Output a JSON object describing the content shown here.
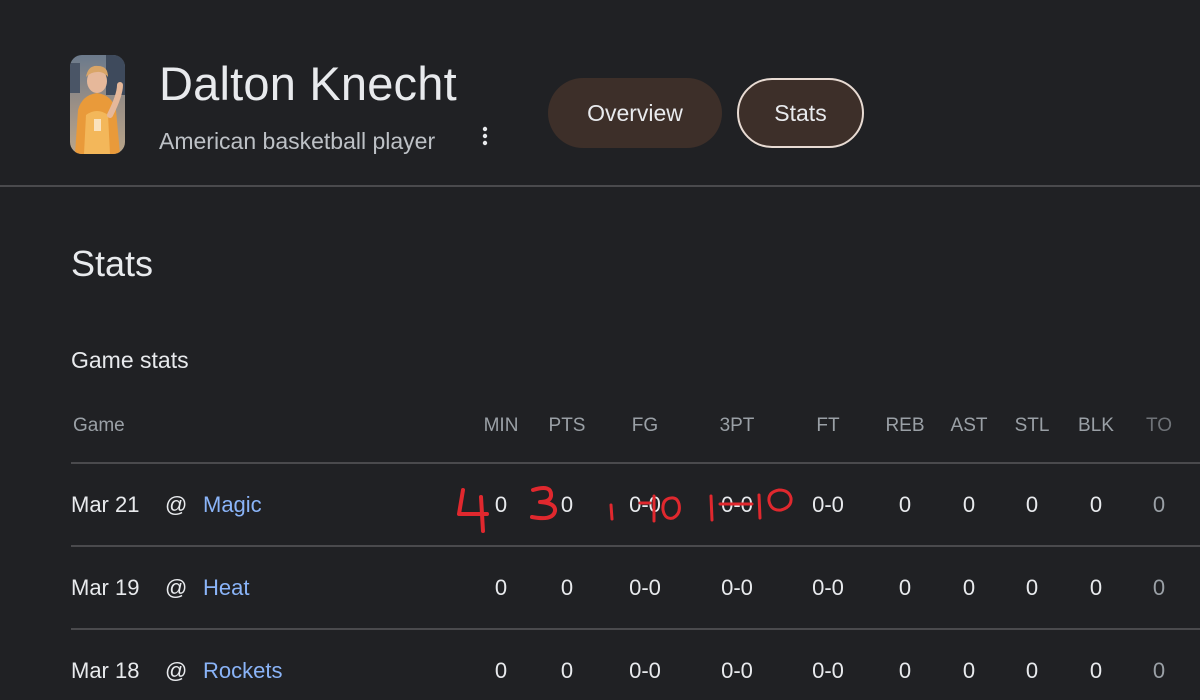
{
  "player": {
    "name": "Dalton Knecht",
    "description": "American basketball player"
  },
  "tabs": {
    "overview": "Overview",
    "stats": "Stats",
    "selected": "Stats"
  },
  "section": {
    "title": "Stats",
    "subtitle": "Game stats"
  },
  "table": {
    "headers": {
      "game": "Game",
      "min": "MIN",
      "pts": "PTS",
      "fg": "FG",
      "tpt": "3PT",
      "ft": "FT",
      "reb": "REB",
      "ast": "AST",
      "stl": "STL",
      "blk": "BLK",
      "to": "TO"
    },
    "rows": [
      {
        "date": "Mar 21",
        "at": "@",
        "opponent": "Magic",
        "min": "0",
        "pts": "0",
        "fg": "0-0",
        "tpt": "0-0",
        "ft": "0-0",
        "reb": "0",
        "ast": "0",
        "stl": "0",
        "blk": "0",
        "to": "0"
      },
      {
        "date": "Mar 19",
        "at": "@",
        "opponent": "Heat",
        "min": "0",
        "pts": "0",
        "fg": "0-0",
        "tpt": "0-0",
        "ft": "0-0",
        "reb": "0",
        "ast": "0",
        "stl": "0",
        "blk": "0",
        "to": "0"
      },
      {
        "date": "Mar 18",
        "at": "@",
        "opponent": "Rockets",
        "min": "0",
        "pts": "0",
        "fg": "0-0",
        "tpt": "0-0",
        "ft": "0-0",
        "reb": "0",
        "ast": "0",
        "stl": "0",
        "blk": "0",
        "to": "0"
      }
    ]
  },
  "handwritten_annotations": {
    "color": "#e0282e",
    "marks": [
      "4",
      "3",
      "1-10",
      "1-10"
    ]
  },
  "colors": {
    "background": "#202124",
    "link": "#8ab4f8",
    "tab_fill": "#3d2f29",
    "annotation": "#e0282e"
  },
  "icons": {
    "more": "more-vert-icon"
  }
}
